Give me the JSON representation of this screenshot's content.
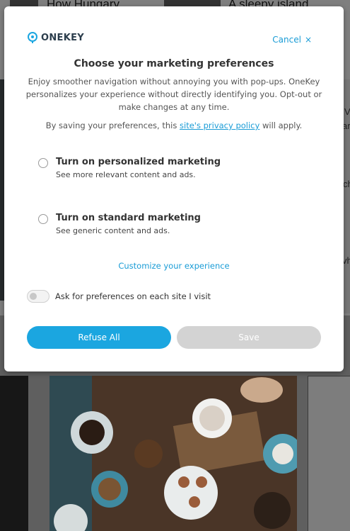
{
  "background": {
    "headline_1": "How Hungary",
    "headline_2": "A sleepy island",
    "side_fragments": [
      "V",
      "arl",
      "ch",
      "vh"
    ]
  },
  "modal": {
    "brand": "ONEKEY",
    "cancel_label": "Cancel",
    "cancel_glyph": "×",
    "title": "Choose your marketing preferences",
    "description": "Enjoy smoother navigation without annoying you with pop-ups. OneKey personalizes your experience without directly identifying you. Opt-out or make changes at any time.",
    "policy_before": "By saving your preferences, this ",
    "policy_link": "site's privacy policy",
    "policy_after": " will apply.",
    "options": [
      {
        "title": "Turn on personalized marketing",
        "subtitle": "See more relevant content and ads.",
        "selected": false
      },
      {
        "title": "Turn on standard marketing",
        "subtitle": "See generic content and ads.",
        "selected": false
      }
    ],
    "customize_label": "Customize your experience",
    "toggle_label": "Ask for preferences on each site I visit",
    "toggle_on": false,
    "refuse_label": "Refuse All",
    "save_label": "Save",
    "colors": {
      "accent": "#1ba6e0",
      "disabled": "#d3d3d3",
      "text": "#333333"
    }
  }
}
